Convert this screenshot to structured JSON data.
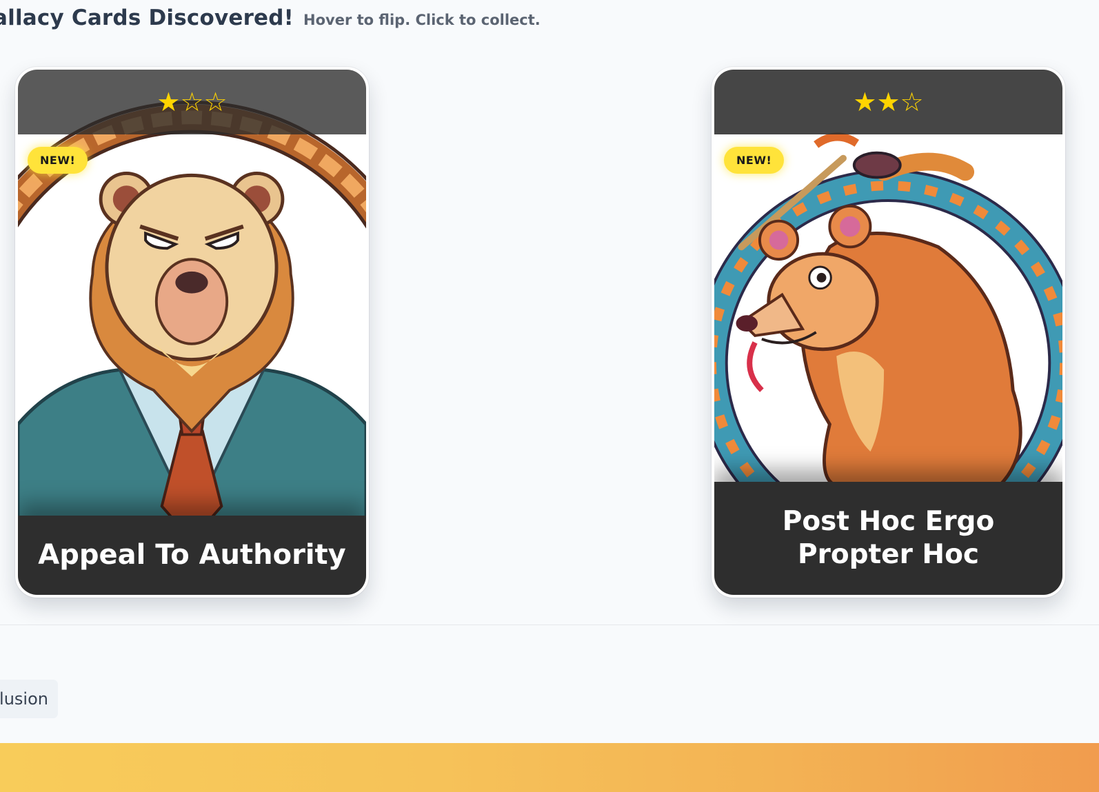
{
  "header": {
    "title": "allacy Cards Discovered!",
    "subtitle": "Hover to flip. Click to collect."
  },
  "cards": [
    {
      "name": "Appeal To Authority",
      "badge": "NEW!",
      "rating": 1,
      "rating_max": 3,
      "stars_filled": "★",
      "stars_empty": "☆☆"
    },
    {
      "name": "Post Hoc Ergo Propter Hoc",
      "badge": "NEW!",
      "rating": 2,
      "rating_max": 3,
      "stars_filled": "★★",
      "stars_empty": "☆"
    }
  ],
  "chip": {
    "label": "lusion"
  },
  "colors": {
    "star": "#ffd400",
    "badge": "#ffe33a",
    "card_bar": "#2e2e2e",
    "banner_start": "#f8cc5a",
    "banner_end": "#f19c4e"
  }
}
